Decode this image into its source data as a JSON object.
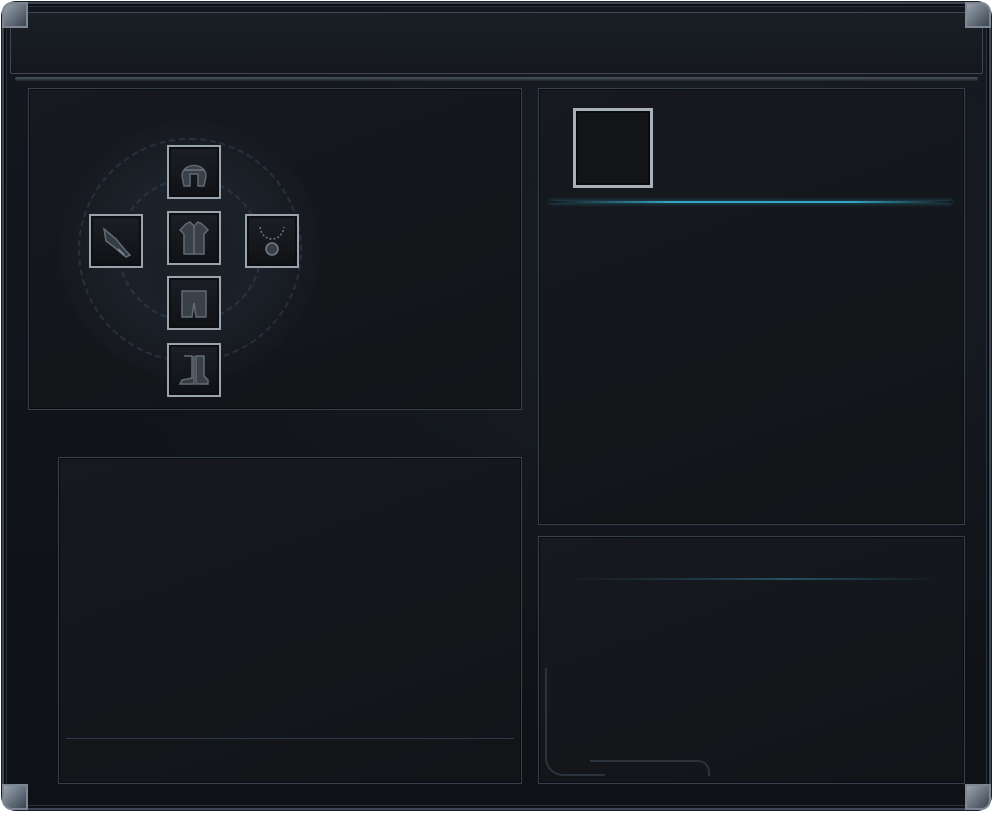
{
  "window": {
    "title": ""
  },
  "equipment": {
    "slots": [
      {
        "id": "helm",
        "icon": "helmet-icon",
        "filled": true
      },
      {
        "id": "weapon",
        "icon": "weapon-icon",
        "filled": true
      },
      {
        "id": "chest",
        "icon": "chest-armor-icon",
        "filled": true
      },
      {
        "id": "amulet",
        "icon": "amulet-icon",
        "filled": true
      },
      {
        "id": "legs",
        "icon": "leg-armor-icon",
        "filled": true
      },
      {
        "id": "boots",
        "icon": "boots-icon",
        "filled": true
      }
    ]
  },
  "detail": {
    "preview_slot_empty": true
  },
  "colors": {
    "background": "#121418",
    "panel_border": "#36414d",
    "slot_border": "#9aa2ab",
    "accent_cyan": "#34a6c4"
  }
}
